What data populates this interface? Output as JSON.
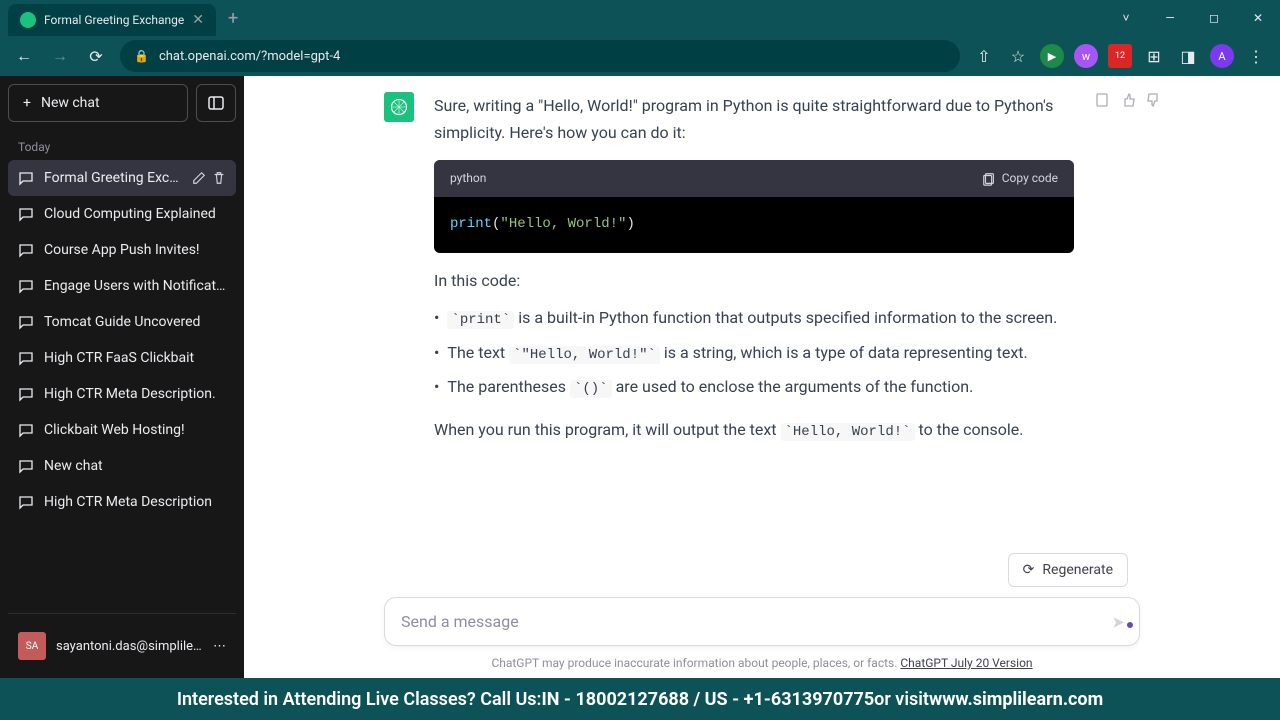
{
  "tab": {
    "title": "Formal Greeting Exchange"
  },
  "url": "chat.openai.com/?model=gpt-4",
  "sidebar": {
    "newchat": "New chat",
    "section": "Today",
    "items": [
      {
        "label": "Formal Greeting Excha"
      },
      {
        "label": "Cloud Computing Explained"
      },
      {
        "label": "Course App Push Invites!"
      },
      {
        "label": "Engage Users with Notification"
      },
      {
        "label": "Tomcat Guide Uncovered"
      },
      {
        "label": "High CTR FaaS Clickbait"
      },
      {
        "label": "High CTR Meta Description."
      },
      {
        "label": "Clickbait Web Hosting!"
      },
      {
        "label": "New chat"
      },
      {
        "label": "High CTR Meta Description"
      }
    ],
    "user": "sayantoni.das@simplile..."
  },
  "message": {
    "intro": "Sure, writing a \"Hello, World!\" program in Python is quite straightforward due to Python's simplicity. Here's how you can do it:",
    "code_lang": "python",
    "copy_label": "Copy code",
    "code_kw": "print",
    "code_str": "\"Hello, World!\"",
    "after_code": "In this code:",
    "bullets": [
      {
        "pre": "",
        "code": "print",
        "post": " is a built-in Python function that outputs specified information to the screen."
      },
      {
        "pre": "The text ",
        "code": "\"Hello, World!\"",
        "post": " is a string, which is a type of data representing text."
      },
      {
        "pre": "The parentheses ",
        "code": "()",
        "post": " are used to enclose the arguments of the function."
      }
    ],
    "outro_pre": "When you run this program, it will output the text ",
    "outro_code": "Hello, World!",
    "outro_post": " to the console."
  },
  "input": {
    "regenerate": "Regenerate",
    "placeholder": "Send a message",
    "disclaimer_pre": "ChatGPT may produce inaccurate information about people, places, or facts. ",
    "disclaimer_link": "ChatGPT July 20 Version"
  },
  "banner": {
    "text_pre": "Interested in Attending Live Classes? Call Us: ",
    "phone": "IN - 18002127688 / US - +1-6313970775",
    "text_mid": " or visit ",
    "url": "www.simplilearn.com"
  },
  "user_avatar": "SA"
}
